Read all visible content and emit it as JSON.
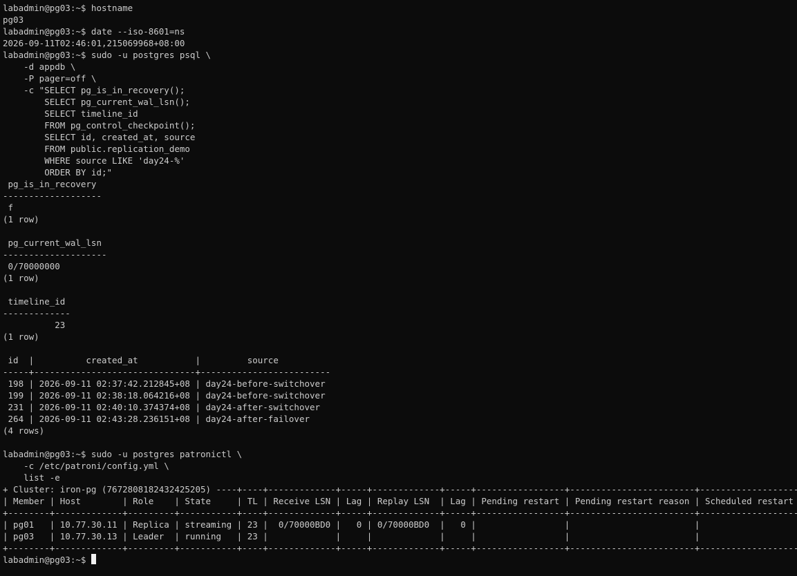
{
  "terminal": {
    "prompt": "labadmin@pg03:~$ ",
    "lines": [
      "labadmin@pg03:~$ hostname",
      "pg03",
      "labadmin@pg03:~$ date --iso-8601=ns",
      "2026-09-11T02:46:01,215069968+08:00",
      "labadmin@pg03:~$ sudo -u postgres psql \\",
      "    -d appdb \\",
      "    -P pager=off \\",
      "    -c \"SELECT pg_is_in_recovery();",
      "        SELECT pg_current_wal_lsn();",
      "        SELECT timeline_id",
      "        FROM pg_control_checkpoint();",
      "        SELECT id, created_at, source",
      "        FROM public.replication_demo",
      "        WHERE source LIKE 'day24-%'",
      "        ORDER BY id;\"",
      " pg_is_in_recovery",
      "-------------------",
      " f",
      "(1 row)",
      "",
      " pg_current_wal_lsn",
      "--------------------",
      " 0/70000000",
      "(1 row)",
      "",
      " timeline_id",
      "-------------",
      "          23",
      "(1 row)",
      "",
      " id  |          created_at           |         source",
      "-----+-------------------------------+-------------------------",
      " 198 | 2026-09-11 02:37:42.212845+08 | day24-before-switchover",
      " 199 | 2026-09-11 02:38:18.064216+08 | day24-before-switchover",
      " 231 | 2026-09-11 02:40:10.374374+08 | day24-after-switchover",
      " 264 | 2026-09-11 02:43:28.236151+08 | day24-after-failover",
      "(4 rows)",
      "",
      "labadmin@pg03:~$ sudo -u postgres patronictl \\",
      "    -c /etc/patroni/config.yml \\",
      "    list -e",
      "+ Cluster: iron-pg (7672808182432425205) ----+----+-------------+-----+-------------+-----+-----------------+------------------------+-------------------+------+",
      "| Member | Host        | Role    | State     | TL | Receive LSN | Lag | Replay LSN  | Lag | Pending restart | Pending restart reason | Scheduled restart | Tags |",
      "+--------+-------------+---------+-----------+----+-------------+-----+-------------+-----+-----------------+------------------------+-------------------+------+",
      "| pg01   | 10.77.30.11 | Replica | streaming | 23 |  0/70000BD0 |   0 | 0/70000BD0  |   0 |                 |                        |                   |      |",
      "| pg03   | 10.77.30.13 | Leader  | running   | 23 |             |     |             |     |                 |                        |                   |      |",
      "+--------+-------------+---------+-----------+----+-------------+-----+-------------+-----+-----------------+------------------------+-------------------+------+"
    ]
  }
}
